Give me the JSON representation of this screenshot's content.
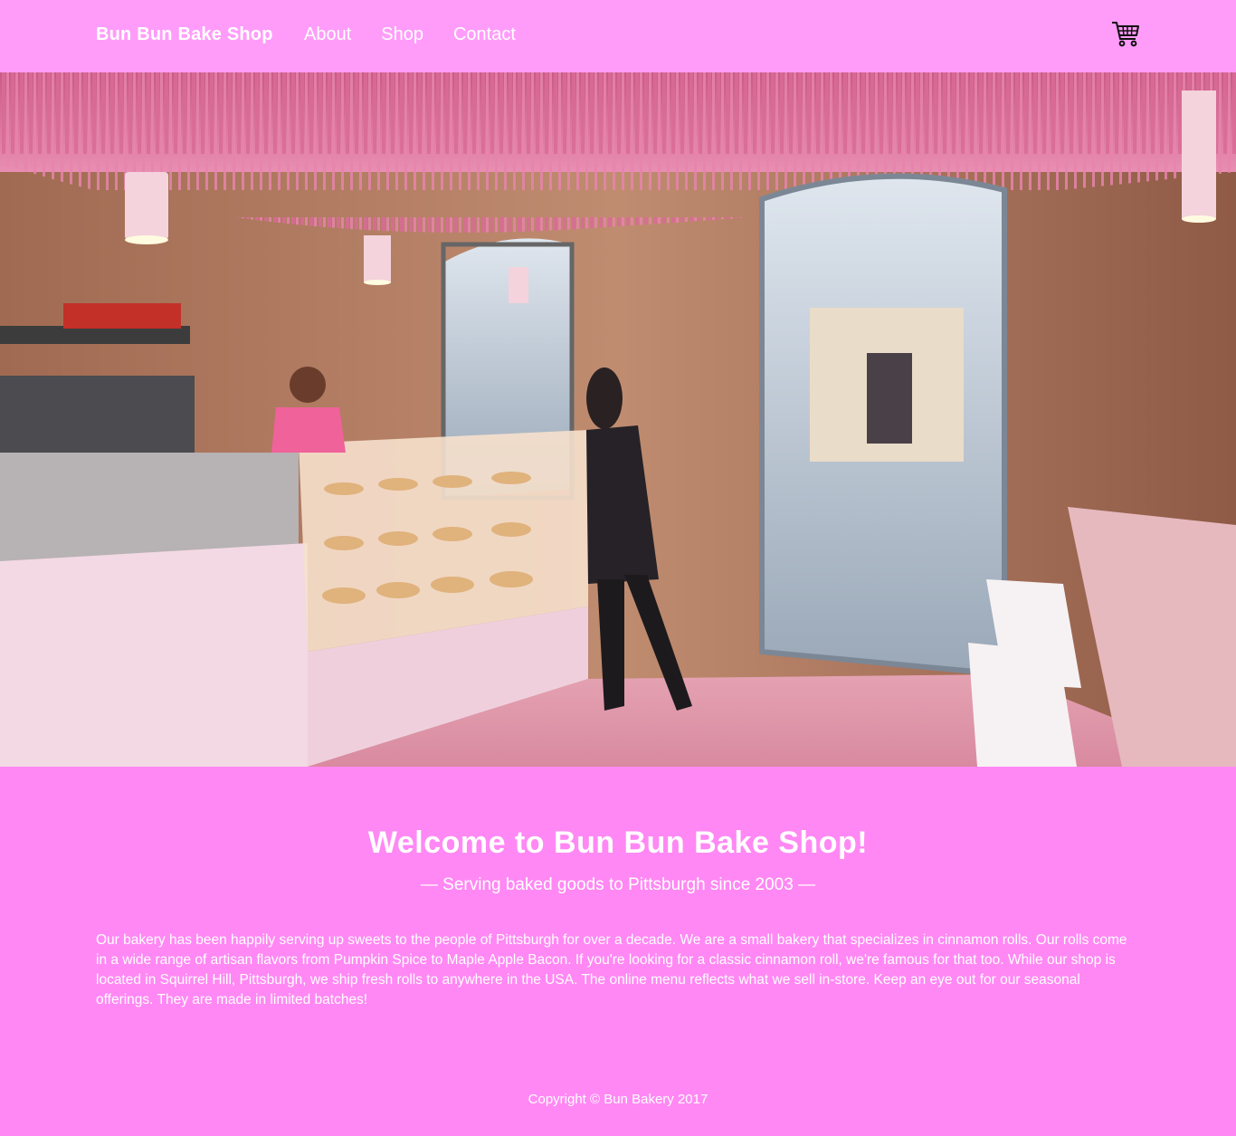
{
  "header": {
    "brand": "Bun Bun Bake Shop",
    "nav": [
      {
        "label": "About"
      },
      {
        "label": "Shop"
      },
      {
        "label": "Contact"
      }
    ],
    "cart_icon": "shopping-cart-icon"
  },
  "hero": {
    "image": "bakery-interior-photo"
  },
  "main": {
    "welcome": "Welcome to Bun Bun Bake Shop!",
    "tagline": "— Serving baked goods to Pittsburgh since 2003 —",
    "description": "Our bakery has been happily serving up sweets to the people of Pittsburgh for over a decade. We are a small bakery that specializes in cinnamon rolls. Our rolls come in a wide range of artisan flavors from Pumpkin Spice to Maple Apple Bacon. If you're looking for a classic cinnamon roll, we're famous for that too. While our shop is located in Squirrel Hill, Pittsburgh, we ship fresh rolls to anywhere in the USA. The online menu reflects what we sell in-store. Keep an eye out for our seasonal offerings. They are made in limited batches!"
  },
  "footer": {
    "copyright": "Copyright © Bun Bakery 2017"
  },
  "colors": {
    "navbar": "#ff9cfa",
    "page": "#ff88f4",
    "text": "#ffffff"
  }
}
